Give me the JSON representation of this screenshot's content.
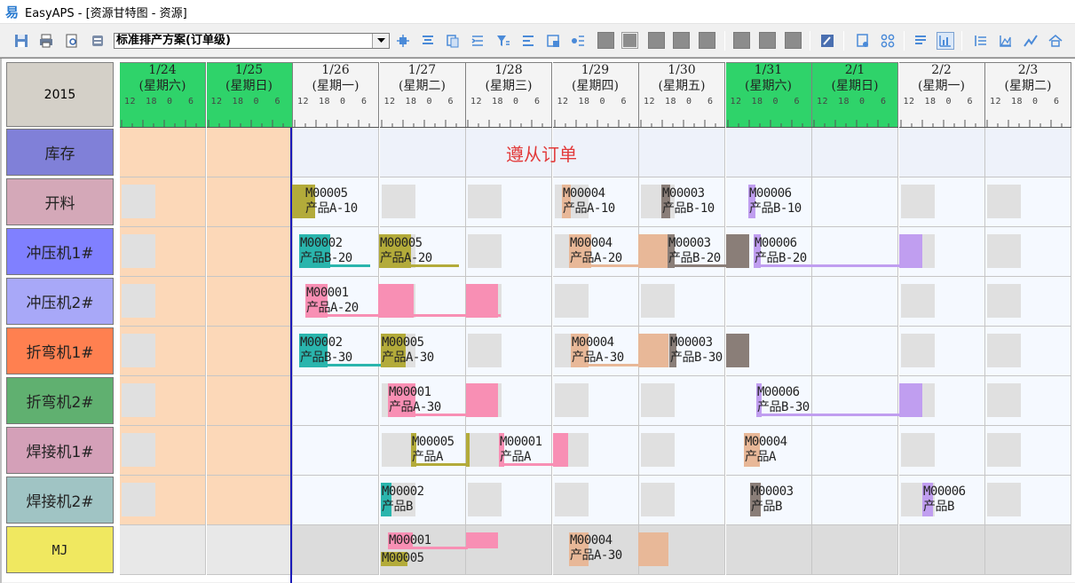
{
  "window": {
    "title": "EasyAPS - [资源甘特图 - 资源]",
    "logo_glyph": "易"
  },
  "toolbar": {
    "scheme_value": "标准排产方案(订单级)",
    "icons": [
      "save-icon",
      "print-icon",
      "print-preview-icon",
      "settings-icon",
      "move-icon",
      "list-icon",
      "copy-icon",
      "indent-icon",
      "filter-icon",
      "align-icon",
      "calendar-icon",
      "grid-icon",
      "flag-icon",
      "edit-icon",
      "report-icon",
      "group-icon",
      "text-icon",
      "chart-bar-icon",
      "list-align-icon",
      "chart-area-icon",
      "chart-line-icon",
      "home-icon"
    ]
  },
  "gantt": {
    "year": "2015",
    "hours": [
      "12",
      "18",
      "0",
      "6"
    ],
    "days": [
      {
        "date": "1/24",
        "weekday": "(星期六)",
        "holiday": true
      },
      {
        "date": "1/25",
        "weekday": "(星期日)",
        "holiday": true
      },
      {
        "date": "1/26",
        "weekday": "(星期一)",
        "holiday": false
      },
      {
        "date": "1/27",
        "weekday": "(星期二)",
        "holiday": false
      },
      {
        "date": "1/28",
        "weekday": "(星期三)",
        "holiday": false
      },
      {
        "date": "1/29",
        "weekday": "(星期四)",
        "holiday": false
      },
      {
        "date": "1/30",
        "weekday": "(星期五)",
        "holiday": false
      },
      {
        "date": "1/31",
        "weekday": "(星期六)",
        "holiday": true
      },
      {
        "date": "2/1",
        "weekday": "(星期日)",
        "holiday": true
      },
      {
        "date": "2/2",
        "weekday": "(星期一)",
        "holiday": false
      },
      {
        "date": "2/3",
        "weekday": "(星期二)",
        "holiday": false
      }
    ],
    "note": "遵从订单",
    "resources": [
      {
        "name": "库存",
        "color": "#8080d8"
      },
      {
        "name": "开料",
        "color": "#d4a8b8"
      },
      {
        "name": "冲压机1#",
        "color": "#8080ff"
      },
      {
        "name": "冲压机2#",
        "color": "#a8a8f8"
      },
      {
        "name": "折弯机1#",
        "color": "#ff8050"
      },
      {
        "name": "折弯机2#",
        "color": "#60b070"
      },
      {
        "name": "焊接机1#",
        "color": "#d4a0b8"
      },
      {
        "name": "焊接机2#",
        "color": "#a0c4c4"
      },
      {
        "name": "MJ",
        "color": "#f0e860"
      }
    ],
    "tasks": {
      "r1": [
        {
          "order": "M00005",
          "product": "产品A-10"
        },
        {
          "order": "M00004",
          "product": "产品A-10"
        },
        {
          "order": "M00003",
          "product": "产品B-10"
        },
        {
          "order": "M00006",
          "product": "产品B-10"
        }
      ],
      "r2": [
        {
          "order": "M00002",
          "product": "产品B-20"
        },
        {
          "order": "M00005",
          "product": "产品A-20"
        },
        {
          "order": "M00004",
          "product": "产品A-20"
        },
        {
          "order": "M00003",
          "product": "产品B-20"
        },
        {
          "order": "M00006",
          "product": "产品B-20"
        }
      ],
      "r3": [
        {
          "order": "M00001",
          "product": "产品A-20"
        }
      ],
      "r4": [
        {
          "order": "M00002",
          "product": "产品B-30"
        },
        {
          "order": "M00005",
          "product": "产品A-30"
        },
        {
          "order": "M00004",
          "product": "产品A-30"
        },
        {
          "order": "M00003",
          "product": "产品B-30"
        }
      ],
      "r5": [
        {
          "order": "M00001",
          "product": "产品A-30"
        },
        {
          "order": "M00006",
          "product": "产品B-30"
        }
      ],
      "r6": [
        {
          "order": "M00005",
          "product": "产品A"
        },
        {
          "order": "M00001",
          "product": "产品A"
        },
        {
          "order": "M00004",
          "product": "产品A"
        }
      ],
      "r7": [
        {
          "order": "M00002",
          "product": "产品B"
        },
        {
          "order": "M00003",
          "product": "产品B"
        },
        {
          "order": "M00006",
          "product": "产品B"
        }
      ],
      "r8": [
        {
          "order": "M00001",
          "product": ""
        },
        {
          "order": "M00005",
          "product": ""
        },
        {
          "order": "M00004",
          "product": "产品A-30"
        }
      ]
    },
    "colors": {
      "holiday_header": "#2fd36a",
      "holiday_body": "#fcd8b8",
      "today_line": "#1a1ab8",
      "note": "#e23a3a",
      "M00001": "#f88fb4",
      "M00002": "#2ab5ad",
      "M00003": "#8a7e78",
      "M00004": "#e8b898",
      "M00005": "#b3ab3a",
      "M00006": "#c09ef0"
    }
  }
}
